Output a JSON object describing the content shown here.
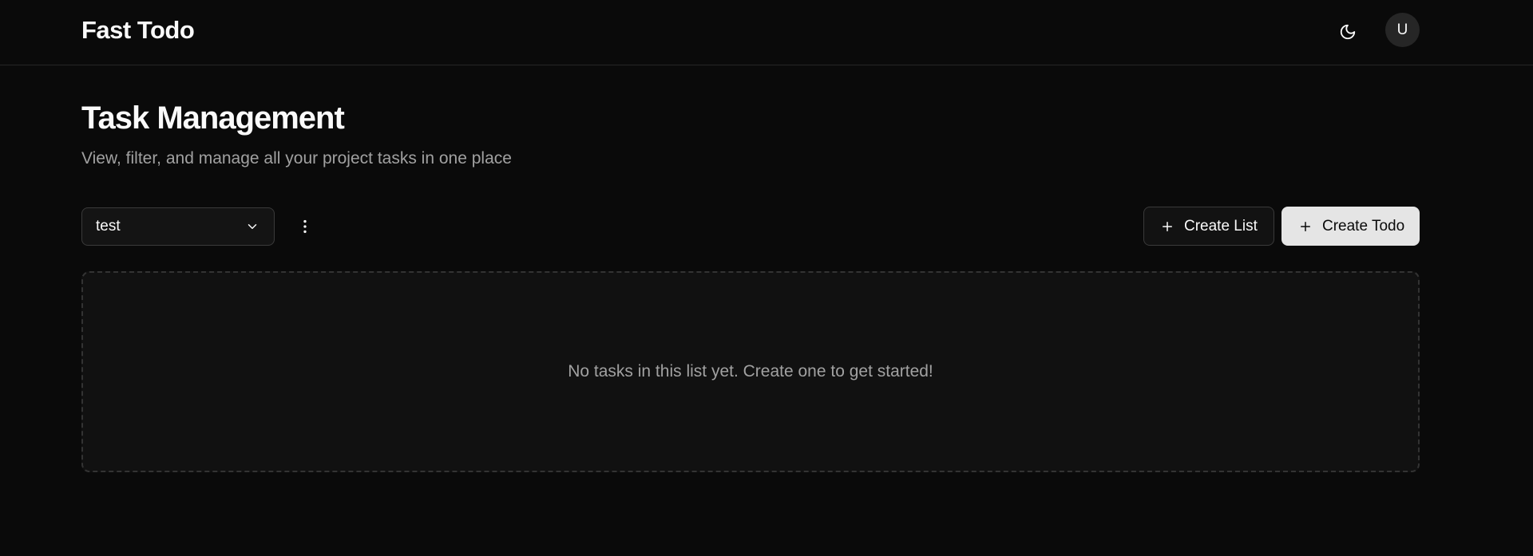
{
  "header": {
    "brand": "Fast Todo",
    "theme_icon": "moon-icon",
    "avatar_initial": "U"
  },
  "page": {
    "title": "Task Management",
    "subtitle": "View, filter, and manage all your project tasks in one place"
  },
  "toolbar": {
    "list_select_value": "test",
    "more_icon": "vertical-ellipsis-icon",
    "create_list_label": "Create List",
    "create_todo_label": "Create Todo"
  },
  "empty_state": {
    "message": "No tasks in this list yet. Create one to get started!"
  },
  "colors": {
    "background": "#0a0a0a",
    "border": "#262626",
    "muted_text": "#a1a1a1",
    "primary_button": "#e5e5e5"
  }
}
